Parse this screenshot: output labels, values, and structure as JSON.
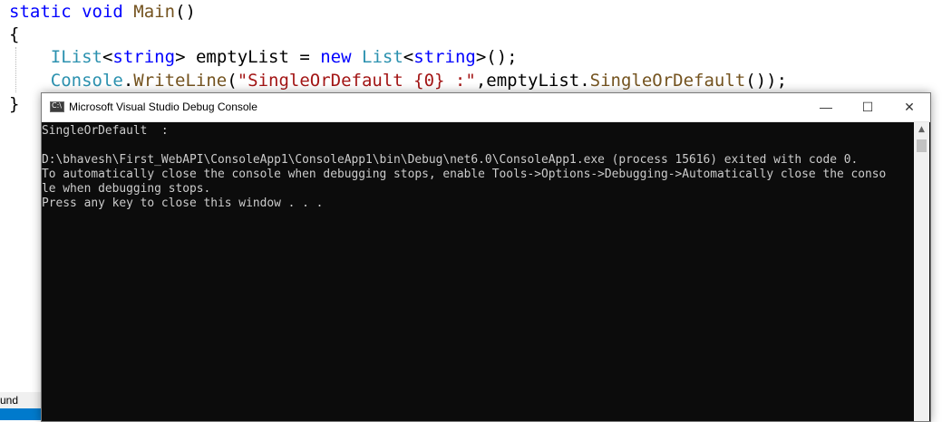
{
  "editor": {
    "line1": {
      "kw": "static void",
      "space": " ",
      "name": "Main",
      "rest": "()"
    },
    "line2": "{",
    "line3": {
      "indent": "    ",
      "type1": "IList",
      "lt": "<",
      "kw1": "string",
      "gt": "> emptyList = ",
      "kw2": "new",
      "sp": " ",
      "type2": "List",
      "lt2": "<",
      "kw3": "string",
      "end": ">();"
    },
    "line4": {
      "indent": "    ",
      "type": "Console",
      "dot": ".",
      "fn": "WriteLine",
      "paren": "(",
      "str": "\"SingleOrDefault {0} :\"",
      "mid": ",emptyList.",
      "fn2": "SingleOrDefault",
      "end": "());"
    },
    "line5": "}",
    "status_text": "und"
  },
  "console_window": {
    "title": "Microsoft Visual Studio Debug Console",
    "icon_label": "C:\\",
    "minimize": "—",
    "maximize": "☐",
    "close": "✕",
    "lines": [
      "SingleOrDefault  :",
      "",
      "D:\\bhavesh\\First_WebAPI\\ConsoleApp1\\ConsoleApp1\\bin\\Debug\\net6.0\\ConsoleApp1.exe (process 15616) exited with code 0.",
      "To automatically close the console when debugging stops, enable Tools->Options->Debugging->Automatically close the conso",
      "le when debugging stops.",
      "Press any key to close this window . . ."
    ],
    "scroll_up": "▲"
  }
}
